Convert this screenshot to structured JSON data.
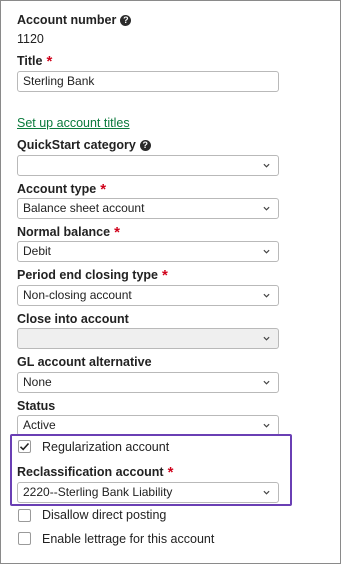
{
  "account_number": {
    "label": "Account number",
    "value": "1120",
    "help_icon": "help-icon"
  },
  "title_field": {
    "label": "Title",
    "value": "Sterling Bank"
  },
  "setup_link": "Set up account titles",
  "quickstart": {
    "label": "QuickStart category",
    "value": "",
    "help_icon": "help-icon"
  },
  "account_type": {
    "label": "Account type",
    "value": "Balance sheet account"
  },
  "normal_balance": {
    "label": "Normal balance",
    "value": "Debit"
  },
  "period_end": {
    "label": "Period end closing type",
    "value": "Non-closing account"
  },
  "close_into": {
    "label": "Close into account",
    "value": ""
  },
  "gl_alt": {
    "label": "GL account alternative",
    "value": "None"
  },
  "status": {
    "label": "Status",
    "value": "Active"
  },
  "regularization": {
    "label": "Regularization account",
    "checked": true
  },
  "reclassification": {
    "label": "Reclassification account",
    "value": "2220--Sterling Bank Liability"
  },
  "disallow_posting": {
    "label": "Disallow direct posting",
    "checked": false
  },
  "lettrage": {
    "label": "Enable lettrage for this account",
    "checked": false
  },
  "colors": {
    "required": "#d0021b",
    "link": "#0a7a3c",
    "highlight": "#6a3fb4"
  }
}
